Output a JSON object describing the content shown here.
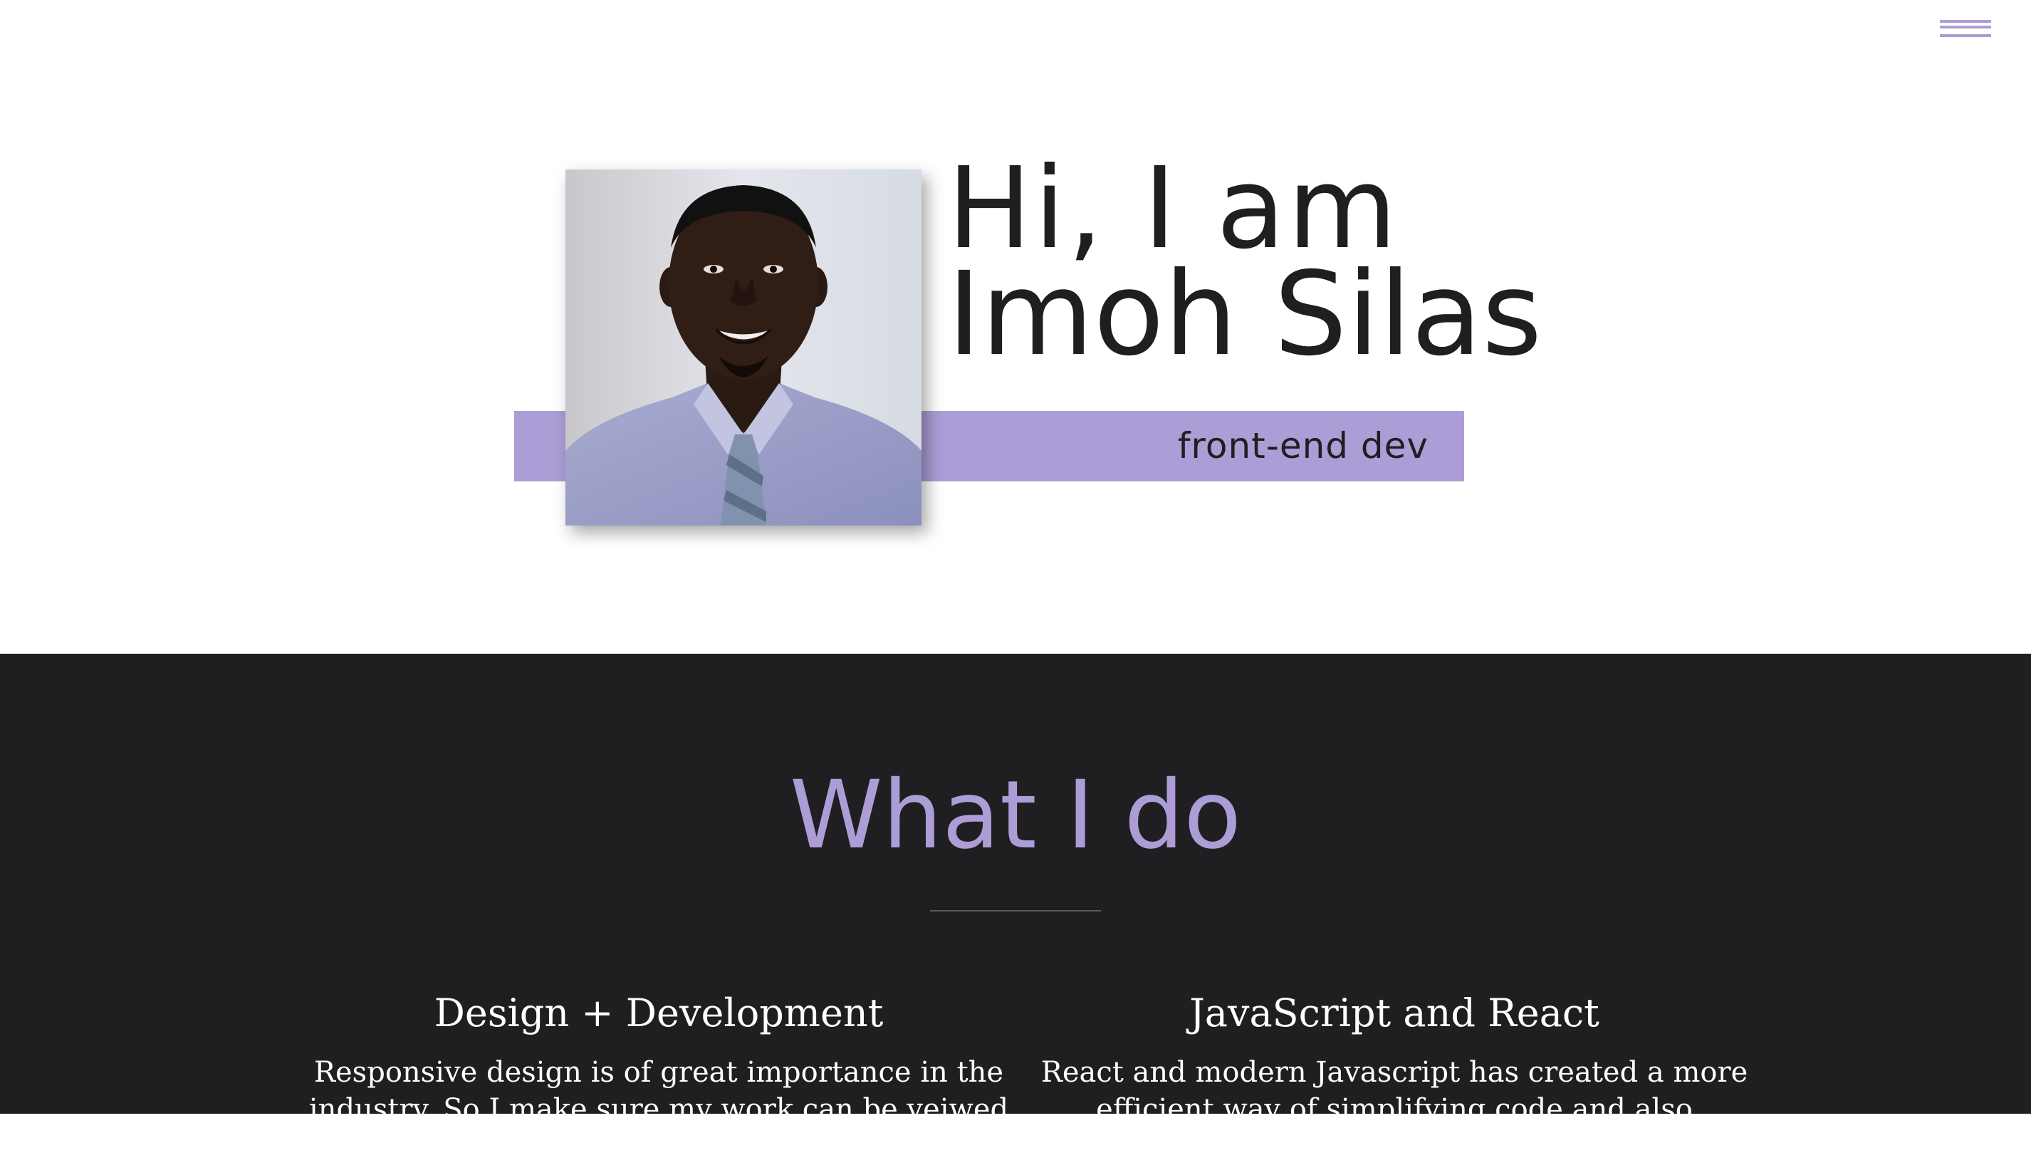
{
  "nav": {
    "menu_icon": "hamburger-menu-icon",
    "accent_color": "#ad9dd6"
  },
  "hero": {
    "greeting": "Hi, I am",
    "name": "Imoh Silas",
    "role": "front-end dev",
    "portrait_alt": "Portrait photo"
  },
  "what_i_do": {
    "title": "What I do",
    "services": [
      {
        "title": "Design + Development",
        "description": "Responsive design is of great importance in the industry, So I make sure my work can be veiwed from mobile to"
      },
      {
        "title": "JavaScript and React",
        "description": "React and modern Javascript has created a more efficient way of simplifying code and also"
      }
    ]
  },
  "colors": {
    "accent": "#ad9dd6",
    "dark": "#1f1f21",
    "text_dark": "#1f1f21",
    "text_light": "#ffffff"
  }
}
